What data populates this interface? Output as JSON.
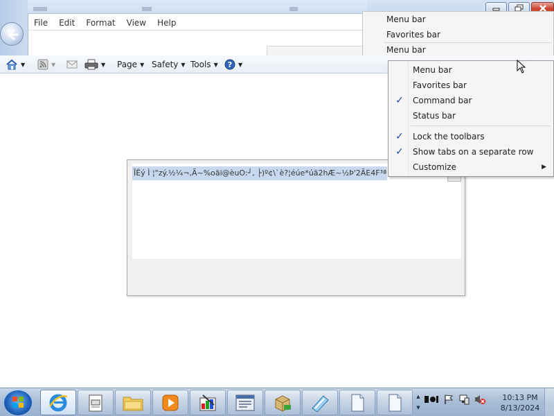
{
  "inner_menubar": {
    "items": [
      "File",
      "Edit",
      "Format",
      "View",
      "Help"
    ]
  },
  "ghost_menu": {
    "items": [
      "Menu bar",
      "Favorites bar",
      "Menu bar"
    ]
  },
  "command_bar": {
    "page_label": "Page",
    "safety_label": "Safety",
    "tools_label": "Tools"
  },
  "context_menu": {
    "items": [
      {
        "label": "Menu bar",
        "checked": false
      },
      {
        "label": "Favorites bar",
        "checked": false
      },
      {
        "label": "Command bar",
        "checked": true
      },
      {
        "label": "Status bar",
        "checked": false
      },
      {
        "label": "Lock the toolbars",
        "checked": true
      },
      {
        "label": "Show tabs on a separate row",
        "checked": true
      },
      {
        "label": "Customize",
        "checked": false,
        "submenu": true
      }
    ]
  },
  "dialog": {
    "garbled_text": "ÎËý Ì ¦\"zý.½¼¬,Ã~%oäi@èuO:┘, ├)º¢\\`è?¦éúe*úã2hÆ~½Þ'2ÃE4F³ªÜYW"
  },
  "taskbar": {
    "time": "10:13 PM",
    "date": "8/13/2024"
  },
  "colors": {
    "accent": "#1a4fa0",
    "selection": "#c8d9ef",
    "close_button": "#c8412c"
  }
}
